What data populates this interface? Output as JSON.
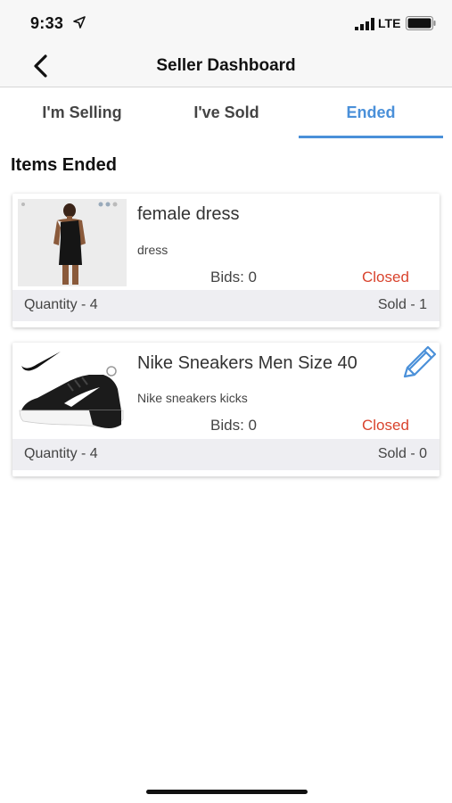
{
  "status_bar": {
    "time": "9:33",
    "network": "LTE"
  },
  "nav": {
    "title": "Seller Dashboard"
  },
  "tabs": [
    {
      "label": "I'm Selling",
      "active": false
    },
    {
      "label": "I've Sold",
      "active": false
    },
    {
      "label": "Ended",
      "active": true
    }
  ],
  "section": {
    "title": "Items Ended"
  },
  "items": [
    {
      "title": "female dress",
      "subtitle": "dress",
      "bids": "Bids: 0",
      "status": "Closed",
      "quantity": "Quantity - 4",
      "sold": "Sold - 1",
      "image": "dress-photo"
    },
    {
      "title": "Nike Sneakers Men Size 40",
      "subtitle": "Nike sneakers kicks",
      "bids": "Bids: 0",
      "status": "Closed",
      "quantity": "Quantity - 4",
      "sold": "Sold - 0",
      "image": "sneaker-photo",
      "editable": true
    }
  ],
  "colors": {
    "accent": "#4a90d9",
    "closed": "#d9442e",
    "footer_bg": "#eeeef2"
  }
}
